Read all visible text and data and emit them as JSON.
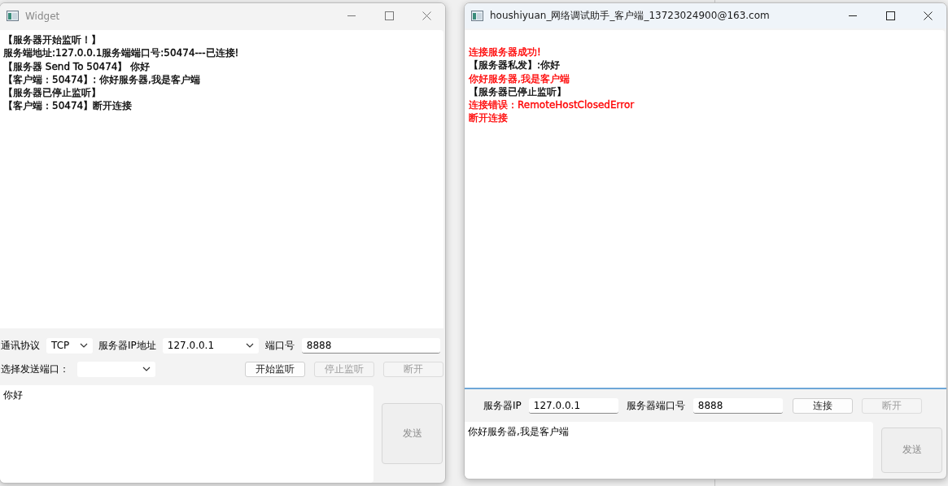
{
  "server_window": {
    "title": "Widget",
    "log": [
      "【服务器开始监听！】",
      "服务端地址:127.0.0.1服务端端口号:50474---已连接!",
      "【服务器 Send To 50474】 你好",
      "【客户端：50474】: 你好服务器,我是客户端",
      "【服务器已停止监听】",
      "【客户端：50474】断开连接"
    ],
    "protocol_label": "通讯协议",
    "protocol_select": "TCP",
    "ip_label": "服务器IP地址",
    "ip_select": "127.0.0.1",
    "port_label": "端口号",
    "port_field": "8888",
    "send_port_label": "选择发送端口：",
    "buttons": [
      {
        "label": "开始监听",
        "disabled": false
      },
      {
        "label": "停止监听",
        "disabled": true
      },
      {
        "label": "断开",
        "disabled": true
      }
    ],
    "message": "你好",
    "send_button": {
      "label": "发送",
      "disabled": true
    }
  },
  "client_window": {
    "title": "houshiyuan_网络调试助手_客户端_13723024900@163.com",
    "log": [
      {
        "text": "连接服务器成功!",
        "color": "#ff0000"
      },
      {
        "text": "【服务器私发】:你好",
        "color": "#000000"
      },
      {
        "text": "你好服务器,我是客户端",
        "color": "#ff0000"
      },
      {
        "text": "【服务器已停止监听】",
        "color": "#000000"
      },
      {
        "text": "连接错误：RemoteHostClosedError",
        "color": "#ff0000"
      },
      {
        "text": "断开连接",
        "color": "#ff0000"
      }
    ],
    "ip_label": "服务器IP",
    "ip_field": "127.0.0.1",
    "port_label": "服务器端口号",
    "port_field": "8888",
    "buttons": [
      {
        "label": "连接",
        "disabled": false
      },
      {
        "label": "断开",
        "disabled": true
      }
    ],
    "message": "你好服务器,我是客户端",
    "send_button": {
      "label": "发送",
      "disabled": true
    }
  }
}
